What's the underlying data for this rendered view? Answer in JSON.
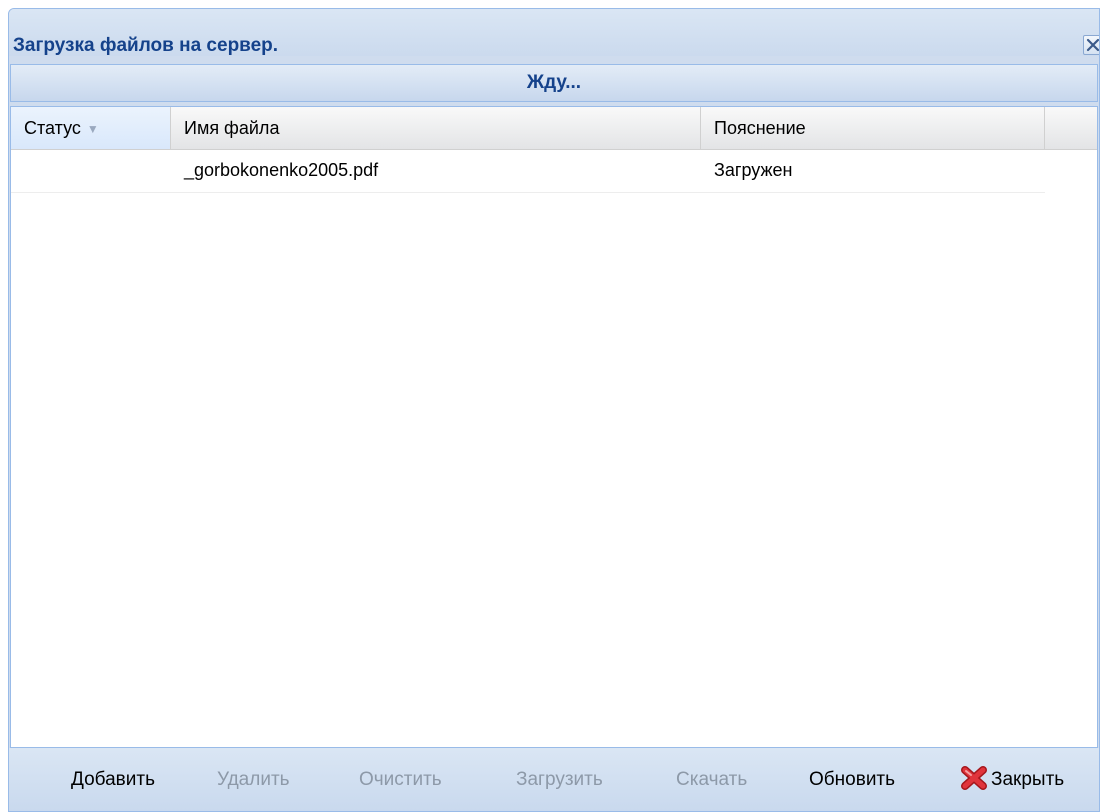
{
  "window": {
    "title": "Загрузка файлов на сервер."
  },
  "status": {
    "text": "Жду..."
  },
  "grid": {
    "columns": [
      {
        "label": "Статус",
        "sorted": true
      },
      {
        "label": "Имя файла"
      },
      {
        "label": "Пояснение"
      }
    ],
    "rows": [
      {
        "status": "",
        "filename": "_gorbokonenko2005.pdf",
        "note": "Загружен"
      }
    ]
  },
  "toolbar": {
    "add": "Добавить",
    "delete": "Удалить",
    "clear": "Очистить",
    "upload": "Загрузить",
    "download": "Скачать",
    "refresh": "Обновить",
    "close": "Закрыть"
  },
  "icons": {
    "close_window": "close-icon",
    "sort": "sort-down-icon",
    "close_button": "red-x-icon"
  },
  "colors": {
    "title_text": "#15428b",
    "frame_border": "#99bbe8",
    "disabled_text": "#8d99a8",
    "close_icon_red": "#d7232b"
  }
}
